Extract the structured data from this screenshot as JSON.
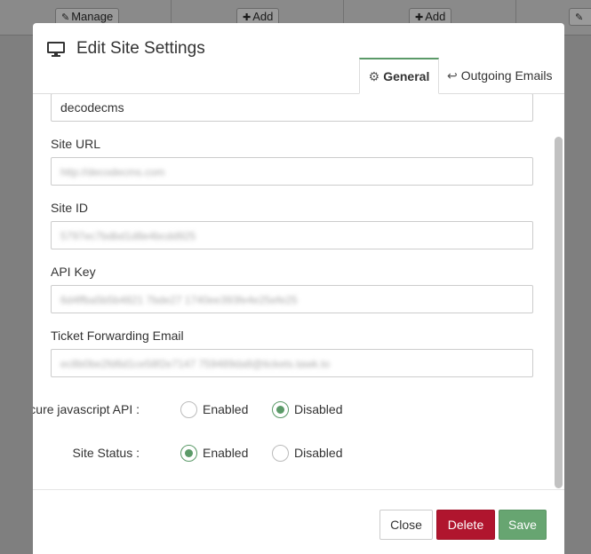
{
  "background": {
    "buttons": [
      {
        "label": "Manage",
        "icon": "pencil-icon"
      },
      {
        "label": "Add",
        "icon": "plus-icon"
      },
      {
        "label": "Add",
        "icon": "plus-icon"
      },
      {
        "label": "",
        "icon": "pencil-icon"
      }
    ]
  },
  "modal": {
    "title": "Edit Site Settings",
    "icon": "monitor-icon",
    "tabs": [
      {
        "label": "General",
        "icon": "gear-icon",
        "active": true
      },
      {
        "label": "Outgoing Emails",
        "icon": "reply-icon",
        "active": false
      }
    ],
    "fields": {
      "site_name": {
        "value": "decodecms"
      },
      "site_url": {
        "label": "Site URL",
        "value": "http://decodecms.com"
      },
      "site_id": {
        "label": "Site ID",
        "value": "5797ec7bdbd1d8e4bcdd925"
      },
      "api_key": {
        "label": "API Key",
        "value": "6d4ffba5b5b4821 7bde27 1740ee393fe4e25efe25"
      },
      "ticket_email": {
        "label": "Ticket Forwarding Email",
        "value": "ec8b0be2fd6d1ce58f2e7147 759489da8@tickets.tawk.to"
      }
    },
    "secure_api": {
      "label": "Secure javascript API :",
      "options": [
        "Enabled",
        "Disabled"
      ],
      "selected": "Disabled"
    },
    "site_status": {
      "label": "Site Status :",
      "options": [
        "Enabled",
        "Disabled"
      ],
      "selected": "Enabled"
    },
    "footer": {
      "close": "Close",
      "delete": "Delete",
      "save": "Save"
    }
  },
  "colors": {
    "accent": "#5b9a68",
    "danger": "#b0152e",
    "save": "#67a571"
  }
}
